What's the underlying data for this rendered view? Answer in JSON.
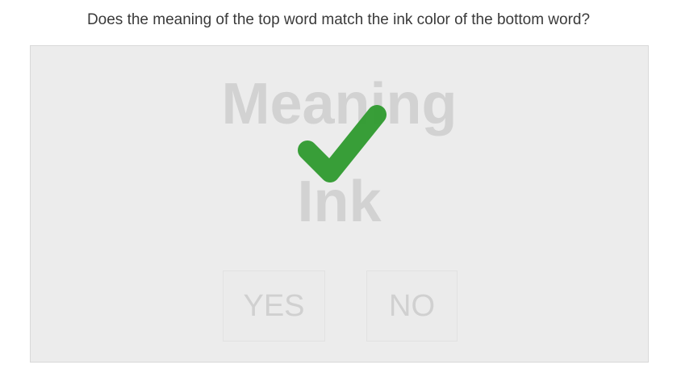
{
  "question": "Does the meaning of the top word match the ink color of the bottom word?",
  "game": {
    "top_word": "Meaning",
    "bottom_word": "Ink",
    "feedback_icon": "checkmark-icon",
    "feedback_color": "#2e9a2e",
    "word_color": "#d2d2d2",
    "panel_color": "#ececec"
  },
  "buttons": {
    "yes_label": "YES",
    "no_label": "NO"
  }
}
